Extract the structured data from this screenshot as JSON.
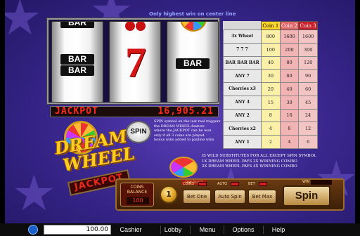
{
  "header": {
    "center_note": "Only highest win on center line"
  },
  "reels": {
    "reel1": {
      "symbol_top": "BAR",
      "symbol_mid_top": "BAR",
      "symbol_mid_bottom": "BAR"
    },
    "reel2": {
      "symbol_mid": "7"
    },
    "reel3": {
      "symbol_mid": "BAR"
    }
  },
  "jackpot": {
    "label": "JACKPOT",
    "value": "16,905.21"
  },
  "logo": {
    "line1": "DREAM",
    "line2": "WHEEL",
    "jackpot": "JACKPOT"
  },
  "spin_badge": "SPIN",
  "rules_text": [
    "SPIN symbol on the last reel triggers",
    "the DREAM WHEEL feature",
    "where the JACKPOT can be won",
    "only if all 3 coins are played.",
    "bonus wins added to payline wins"
  ],
  "wild_notes": [
    "IS WILD SUBSTITUTES FOR ALL EXCEPT SPIN SYMBOL",
    "1X DREAM WHEEL PAYS 2X WINNING COMBO",
    "2X DREAM WHEEL PAYS 4X WINNING COMBO"
  ],
  "paytable": {
    "headers": [
      "Coin 1",
      "Coin 2",
      "Coin 3"
    ],
    "rows": [
      {
        "symbol": "3x Wheel",
        "values": [
          "800",
          "1600",
          "1600"
        ]
      },
      {
        "symbol": "7 7 7",
        "values": [
          "100",
          "200",
          "300"
        ]
      },
      {
        "symbol": "BAR BAR BAR",
        "values": [
          "40",
          "80",
          "120"
        ]
      },
      {
        "symbol": "ANY 7",
        "values": [
          "30",
          "60",
          "90"
        ]
      },
      {
        "symbol": "Cherries x3",
        "values": [
          "20",
          "40",
          "60"
        ]
      },
      {
        "symbol": "ANY 3",
        "values": [
          "15",
          "30",
          "45"
        ]
      },
      {
        "symbol": "ANY 2",
        "values": [
          "8",
          "16",
          "24"
        ]
      },
      {
        "symbol": "Cherries x2",
        "values": [
          "4",
          "8",
          "12"
        ]
      },
      {
        "symbol": "ANY 1",
        "values": [
          "2",
          "4",
          "6"
        ]
      }
    ]
  },
  "controls": {
    "coins_balance_label": "COINS\nBALANCE",
    "coins_balance_value": "100",
    "coin_value": "1",
    "spin_to_bet": "SPIN TO BET",
    "coins_label": "COINS",
    "auto_label": "AUTO",
    "bet_label": "BET",
    "win_label": "WIN",
    "bet_one": "Bet One",
    "auto_spin": "Auto Spin",
    "bet_max": "Bet Max",
    "spin": "Spin"
  },
  "bottom_bar": {
    "balance": "100.00",
    "menu": [
      "Cashier",
      "Lobby",
      "Menu",
      "Options",
      "Help"
    ]
  },
  "colors": {
    "jackpot": "#ff2a1a",
    "background": "#3b2890",
    "gold": "#ffcc22"
  }
}
